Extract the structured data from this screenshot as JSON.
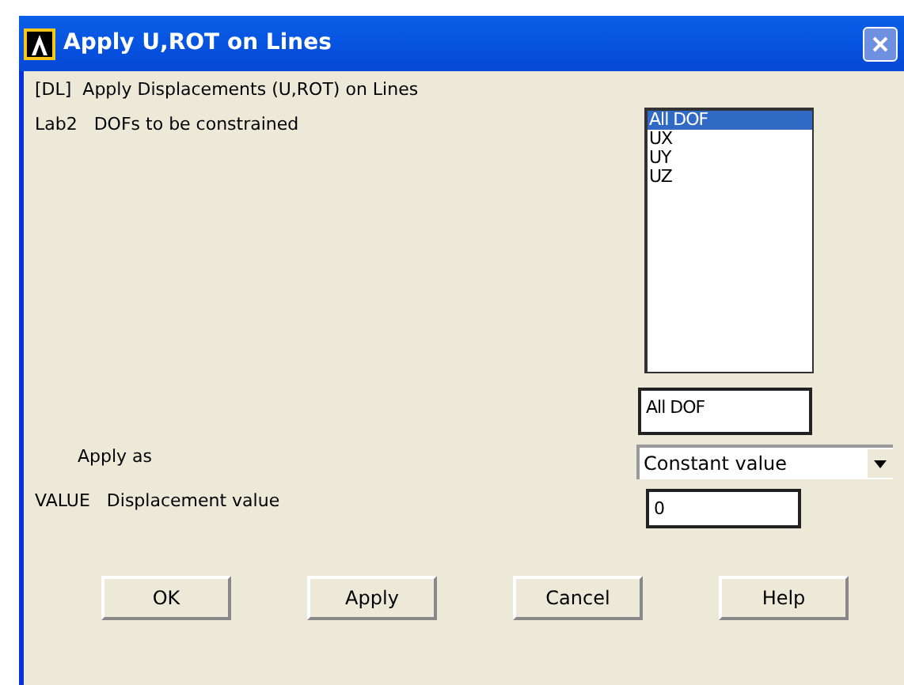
{
  "window": {
    "title": "Apply U,ROT on Lines"
  },
  "heading": "[DL]  Apply Displacements (U,ROT) on Lines",
  "dofs": {
    "code": "Lab2",
    "label": "DOFs to be constrained",
    "options": [
      {
        "label": "All DOF",
        "selected": true
      },
      {
        "label": "UX",
        "selected": false
      },
      {
        "label": "UY",
        "selected": false
      },
      {
        "label": "UZ",
        "selected": false
      }
    ],
    "value": "All DOF"
  },
  "apply_as": {
    "label": "Apply as",
    "value": "Constant value"
  },
  "displacement": {
    "code": "VALUE",
    "label": "Displacement value",
    "value": "0"
  },
  "buttons": [
    "OK",
    "Apply",
    "Cancel",
    "Help"
  ]
}
